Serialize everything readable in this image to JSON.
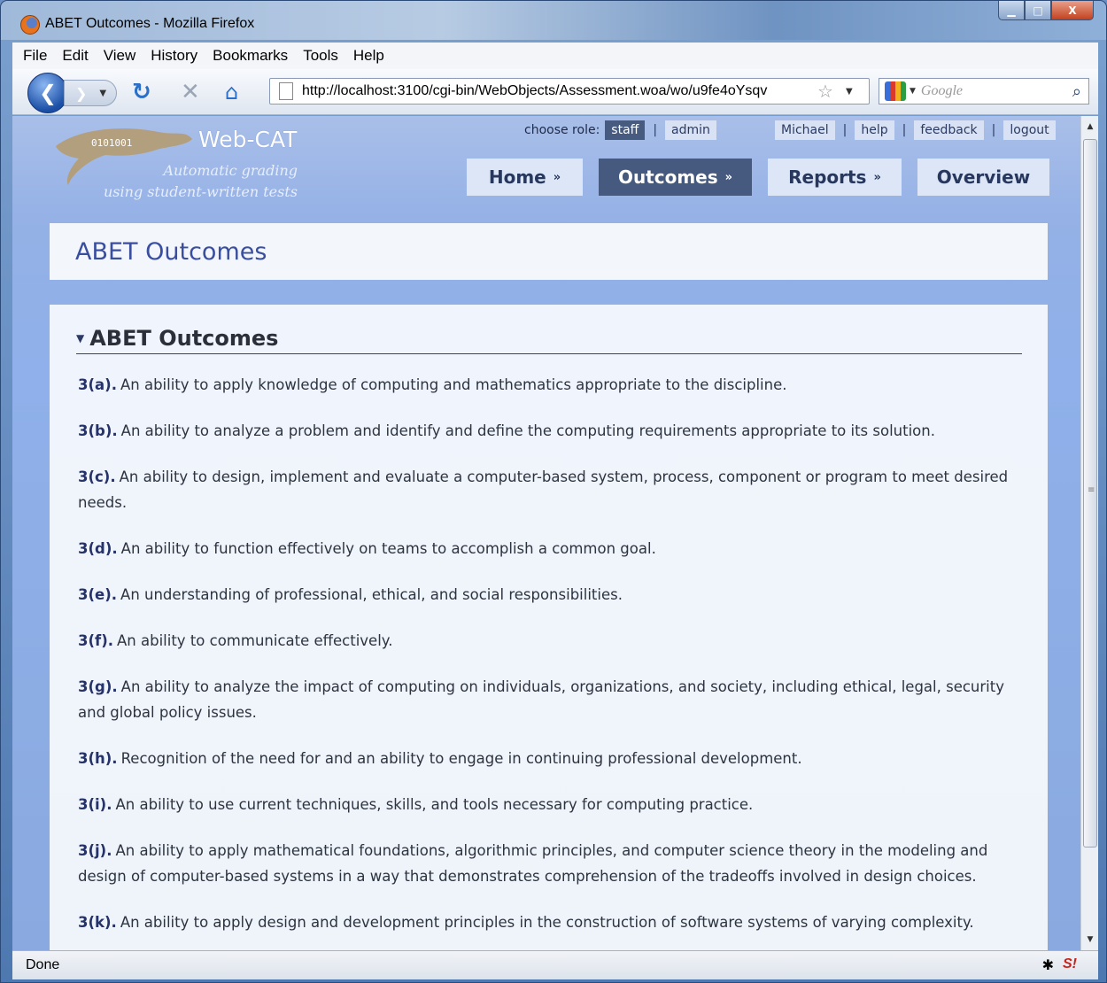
{
  "window": {
    "title": "ABET Outcomes - Mozilla Firefox",
    "minimize_glyph": "▁",
    "maximize_glyph": "□",
    "close_glyph": "X"
  },
  "menu": [
    "File",
    "Edit",
    "View",
    "History",
    "Bookmarks",
    "Tools",
    "Help"
  ],
  "navigation": {
    "url": "http://localhost:3100/cgi-bin/WebObjects/Assessment.woa/wo/u9fe4oYsqv",
    "search_placeholder": "Google"
  },
  "site": {
    "brand": "Web-CAT",
    "tagline_line1": "Automatic grading",
    "tagline_line2": "using student-written tests",
    "role_label": "choose role:",
    "roles": [
      "staff",
      "admin"
    ],
    "active_role": "staff",
    "user_links": [
      "Michael",
      "help",
      "feedback",
      "logout"
    ],
    "tabs": [
      {
        "label": "Home",
        "suffix": "»"
      },
      {
        "label": "Outcomes",
        "suffix": "»"
      },
      {
        "label": "Reports",
        "suffix": "»"
      },
      {
        "label": "Overview",
        "suffix": ""
      }
    ],
    "active_tab": "Outcomes"
  },
  "page": {
    "title": "ABET Outcomes",
    "section_title": "ABET Outcomes",
    "outcomes": [
      {
        "code": "3(a).",
        "text": "An ability to apply knowledge of computing and mathematics appropriate to the discipline."
      },
      {
        "code": "3(b).",
        "text": "An ability to analyze a problem and identify and define the computing requirements appropriate to its solution."
      },
      {
        "code": "3(c).",
        "text": "An ability to design, implement and evaluate a computer-based system, process, component or program to meet desired needs."
      },
      {
        "code": "3(d).",
        "text": "An ability to function effectively on teams to accomplish a common goal."
      },
      {
        "code": "3(e).",
        "text": "An understanding of professional, ethical, and social responsibilities."
      },
      {
        "code": "3(f).",
        "text": "An ability to communicate effectively."
      },
      {
        "code": "3(g).",
        "text": "An ability to analyze the impact of computing on individuals, organizations, and society, including ethical, legal, security and global policy issues."
      },
      {
        "code": "3(h).",
        "text": "Recognition of the need for and an ability to engage in continuing professional development."
      },
      {
        "code": "3(i).",
        "text": "An ability to use current techniques, skills, and tools necessary for computing practice."
      },
      {
        "code": "3(j).",
        "text": "An ability to apply mathematical foundations, algorithmic principles, and computer science theory in the modeling and design of computer-based systems in a way that demonstrates comprehension of the tradeoffs involved in design choices."
      },
      {
        "code": "3(k).",
        "text": "An ability to apply design and development principles in the construction of software systems of varying complexity."
      }
    ]
  },
  "status": {
    "text": "Done",
    "ext_label": "S!"
  },
  "colors": {
    "nav_active": "#465a80",
    "nav_inactive": "#dde6f7",
    "title_text": "#3a4ea0",
    "page_background": "#8fb0ea"
  }
}
